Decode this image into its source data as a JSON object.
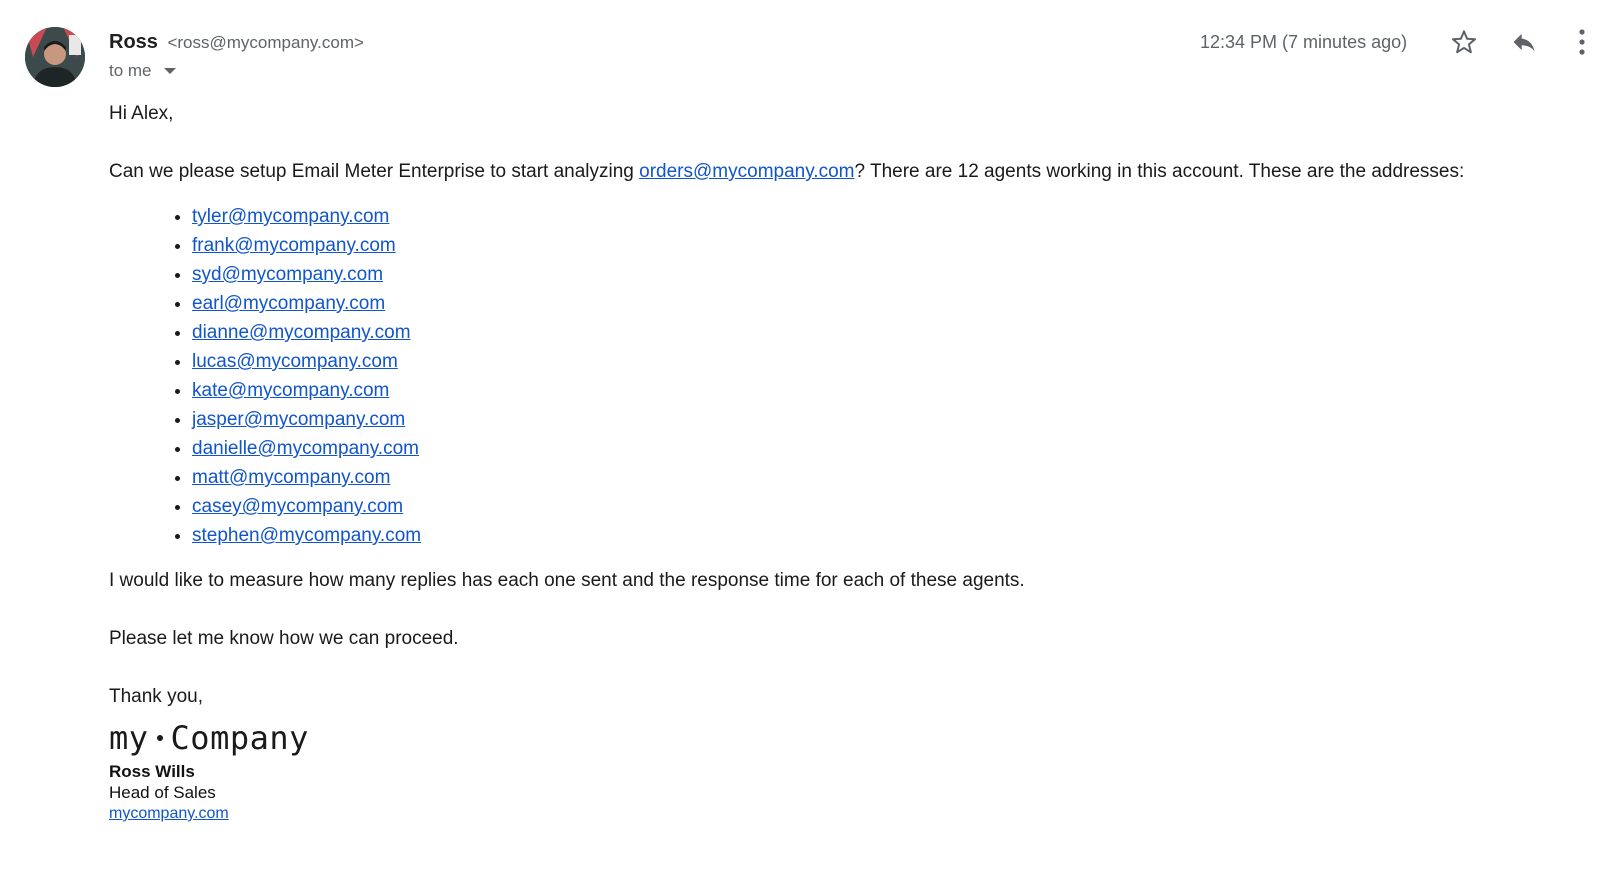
{
  "message": {
    "sender": {
      "name": "Ross",
      "email": "<ross@mycompany.com>"
    },
    "recipient_label": "to me",
    "timestamp": "12:34 PM (7 minutes ago)",
    "icons": {
      "star": "star-outline-icon",
      "reply": "reply-icon",
      "more": "more-vertical-icon",
      "dropdown": "caret-down-icon"
    }
  },
  "body": {
    "greeting": "Hi Alex,",
    "intro_before": "Can we please setup Email Meter Enterprise to start analyzing ",
    "intro_link": "orders@mycompany.com",
    "intro_after": "? There are 12 agents working in this account. These are the addresses:",
    "agents": [
      "tyler@mycompany.com",
      "frank@mycompany.com",
      "syd@mycompany.com",
      "earl@mycompany.com",
      "dianne@mycompany.com",
      "lucas@mycompany.com",
      "kate@mycompany.com",
      "jasper@mycompany.com",
      "danielle@mycompany.com",
      "matt@mycompany.com",
      "casey@mycompany.com",
      "stephen@mycompany.com"
    ],
    "measure": "I would like to measure how many replies has each one sent and the response time for each of these agents.",
    "proceed": "Please let me know how we can proceed.",
    "thanks": "Thank you,"
  },
  "signature": {
    "logo_left": "my",
    "logo_right": "Company",
    "name": "Ross Wills",
    "title": "Head of Sales",
    "website": "mycompany.com"
  },
  "colors": {
    "link": "#1155cc",
    "muted": "#5f6368",
    "text": "#1a1a1a"
  }
}
